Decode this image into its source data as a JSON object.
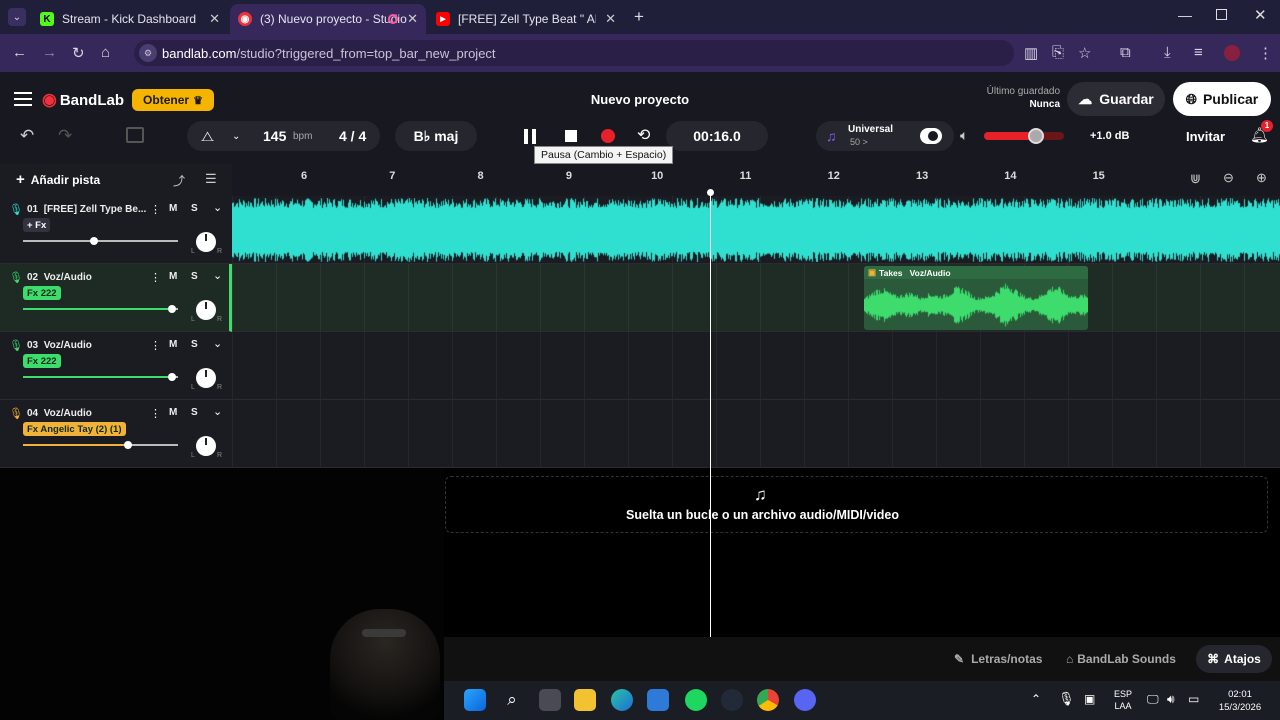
{
  "browser": {
    "tabs": [
      {
        "title": "Stream - Kick Dashboard",
        "active": false,
        "favicon": "kick-icon"
      },
      {
        "title": "(3) Nuevo proyecto - Studio",
        "active": true,
        "favicon": "bandlab-icon"
      },
      {
        "title": "[FREE] Zell Type Beat \" ANTES D",
        "active": false,
        "favicon": "youtube-icon"
      }
    ],
    "url_domain": "bandlab.com",
    "url_path": "/studio?triggered_from=top_bar_new_project"
  },
  "app": {
    "logo": "BandLab",
    "get_button": "Obtener",
    "project_title": "Nuevo proyecto",
    "last_saved_label": "Último guardado",
    "last_saved_value": "Nunca",
    "save_button": "Guardar",
    "publish_button": "Publicar"
  },
  "toolbar": {
    "tempo": "145",
    "tempo_unit": "bpm",
    "time_signature": "4 / 4",
    "key": "B♭ maj",
    "time_display": "00:16.0",
    "pause_tooltip": "Pausa (Cambio + Espacio)",
    "preset_name": "Universal",
    "preset_value": "50 >",
    "volume_db": "+1.0 dB",
    "volume_level": 0.65,
    "invite_button": "Invitar",
    "notification_count": "1"
  },
  "tracks_panel": {
    "add_track": "Añadir pista"
  },
  "ruler": {
    "bars": [
      "6",
      "7",
      "8",
      "9",
      "10",
      "11",
      "12",
      "13",
      "14",
      "15"
    ]
  },
  "tracks": [
    {
      "number": "01",
      "name": "[FREE] Zell Type Be...",
      "fx": "+ Fx",
      "fx_color": "#333340",
      "mute": "M",
      "solo": "S",
      "volume": 0.47,
      "color": "#2fe0d0"
    },
    {
      "number": "02",
      "name": "Voz/Audio",
      "fx": "Fx 222",
      "fx_color": "#3ddc6d",
      "mute": "M",
      "solo": "S",
      "volume": 0.98,
      "color": "#3ddc6d"
    },
    {
      "number": "03",
      "name": "Voz/Audio",
      "fx": "Fx 222",
      "fx_color": "#3ddc6d",
      "mute": "M",
      "solo": "S",
      "volume": 0.98,
      "color": "#3ddc6d"
    },
    {
      "number": "04",
      "name": "Voz/Audio",
      "fx": "Fx Angelic Tay (2) (1)",
      "fx_color": "#f2b23a",
      "mute": "M",
      "solo": "S",
      "volume": 0.69,
      "color": "#f2b23a"
    }
  ],
  "clip": {
    "takes_label": "Takes",
    "clip_name": "Voz/Audio"
  },
  "dropzone": {
    "text": "Suelta un bucle o un archivo audio/MIDI/video"
  },
  "bottom": {
    "lyrics": "Letras/notas",
    "sounds": "BandLab Sounds",
    "shortcuts": "Atajos"
  },
  "taskbar": {
    "language": "ESP",
    "region": "LAA",
    "time": "02:01",
    "date": "15/3/2026"
  },
  "colors": {
    "accent_purple": "#37285c",
    "bandlab_red": "#f0303a",
    "record_red": "#e8202a",
    "cyan_wave": "#2fe0d0",
    "green_wave": "#3ddc6d"
  }
}
